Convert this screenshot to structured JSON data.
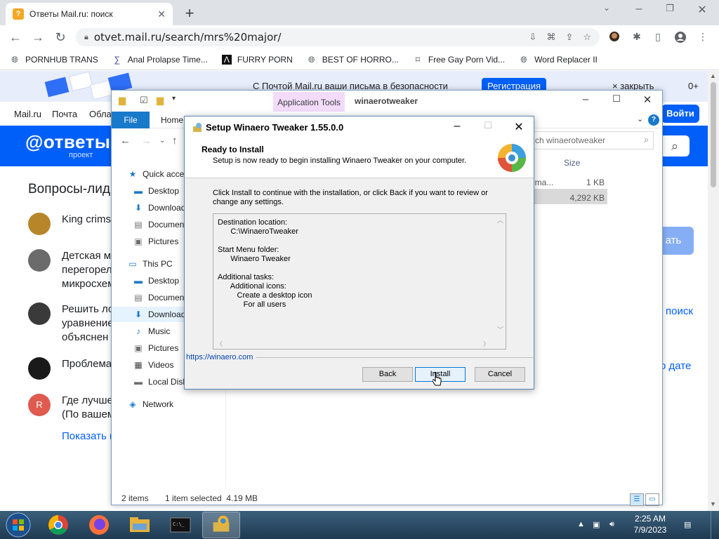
{
  "browser": {
    "tab_title": "Ответы Mail.ru: поиск",
    "url": "otvet.mail.ru/search/mrs%20major/",
    "bookmarks": [
      {
        "label": "PORNHUB TRANS",
        "icon": "globe-icon"
      },
      {
        "label": "Anal Prolapse Time...",
        "icon": "bracket-icon"
      },
      {
        "label": "FURRY PORN",
        "icon": "lambda-icon"
      },
      {
        "label": "BEST OF HORRO...",
        "icon": "globe-icon"
      },
      {
        "label": "Free Gay Porn Vid...",
        "icon": "tag-icon"
      },
      {
        "label": "Word Replacer II",
        "icon": "globe-icon"
      }
    ]
  },
  "page": {
    "banner_text": "С Почтой Mail.ru ваши письма в безопасности",
    "register_label": "Регистрация",
    "close_label": "закрыть",
    "counter": "0+",
    "nav": [
      "Mail.ru",
      "Почта",
      "Обла"
    ],
    "login_label": "Войти",
    "brand": "@ответы",
    "brand_sub": "проект",
    "section_title": "Вопросы-лид",
    "questions": [
      {
        "text": "King crims",
        "color": "#b8862a"
      },
      {
        "text": "Детская м\nперегорел\nмикросхем",
        "color": "#6b6b6b"
      },
      {
        "text": "Решить ло\nуравнение\nобъяснен",
        "color": "#3a3a3a"
      },
      {
        "text": "Проблема",
        "color": "#1a1a1a"
      },
      {
        "text": "Где лучше\n(По вашем",
        "color": "#e05a50"
      }
    ],
    "question_initial": "R",
    "show_more": "Показать (",
    "ask_label": "ать",
    "search_link": "поиск",
    "date_link": "о дате"
  },
  "explorer": {
    "app_tools": "Application Tools",
    "folder_name": "winaerotweaker",
    "ribbon_file": "File",
    "ribbon_home": "Home",
    "search_placeholder": "ch winaerotweaker",
    "col_size": "Size",
    "col_name_fragment": "nma...",
    "file_sizes": [
      "1 KB",
      "4,292 KB"
    ],
    "nav_items": [
      "Quick access",
      "Desktop",
      "Downloads",
      "Documents",
      "Pictures",
      "This PC",
      "Desktop",
      "Documents",
      "Downloads",
      "Music",
      "Pictures",
      "Videos",
      "Local Disk",
      "Network"
    ],
    "status_items": "2 items",
    "status_selected": "1 item selected  4.19 MB"
  },
  "setup": {
    "title": "Setup Winaero Tweaker 1.55.0.0",
    "heading": "Ready to Install",
    "subheading": "Setup is now ready to begin installing Winaero Tweaker on your computer.",
    "intro": "Click Install to continue with the installation, or click Back if you want to review or change any settings.",
    "memo": "Destination location:\n      C:\\WinaeroTweaker\n\nStart Menu folder:\n      Winaero Tweaker\n\nAdditional tasks:\n      Additional icons:\n         Create a desktop icon\n            For all users",
    "link": "https://winaero.com",
    "back_label": "Back",
    "install_label": "Install",
    "cancel_label": "Cancel"
  },
  "taskbar": {
    "time": "2:25 AM",
    "date": "7/9/2023"
  }
}
